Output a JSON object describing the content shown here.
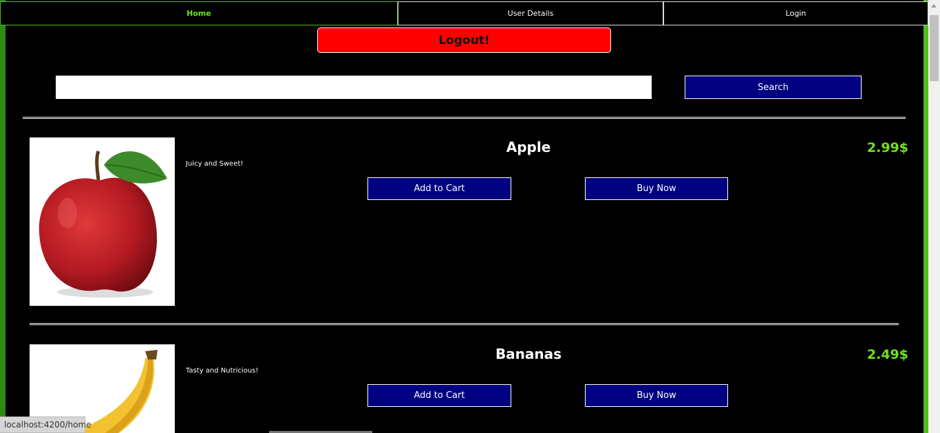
{
  "nav": {
    "items": [
      {
        "label": "Home",
        "active": true
      },
      {
        "label": "User Details",
        "active": false
      },
      {
        "label": "Login",
        "active": false
      }
    ]
  },
  "logout_label": "Logout!",
  "search": {
    "value": "",
    "placeholder": "",
    "button_label": "Search"
  },
  "products": [
    {
      "name": "Apple",
      "description": "Juicy and Sweet!",
      "price": "2.99$",
      "add_to_cart": "Add to Cart",
      "buy_now": "Buy Now",
      "image_icon": "apple-image"
    },
    {
      "name": "Bananas",
      "description": "Tasty and Nutricious!",
      "price": "2.49$",
      "add_to_cart": "Add to Cart",
      "buy_now": "Buy Now",
      "image_icon": "banana-image"
    }
  ],
  "status_bar": {
    "url": "localhost:4200/home"
  },
  "colors": {
    "accent_green": "#6fe21c",
    "logout_red": "#ff0000",
    "button_navy": "#000080"
  }
}
